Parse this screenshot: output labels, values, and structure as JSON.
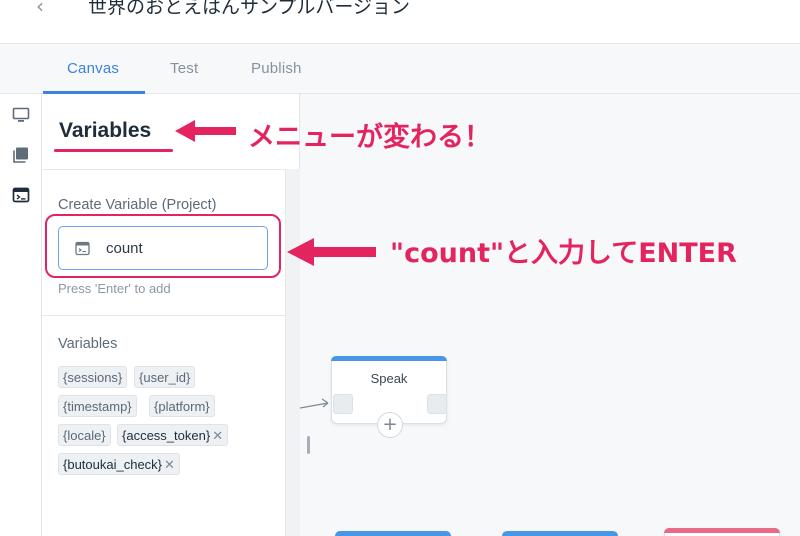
{
  "header": {
    "back_icon": "chevron-left-icon",
    "project_title": "世界のおとえはんサンプルバージョン"
  },
  "tabs": [
    {
      "label": "Canvas",
      "active": true
    },
    {
      "label": "Test",
      "active": false
    },
    {
      "label": "Publish",
      "active": false
    }
  ],
  "rail": {
    "icons": [
      "monitor-icon",
      "library-icon",
      "variables-icon"
    ]
  },
  "panel": {
    "title": "Variables",
    "create_label": "Create Variable (Project)",
    "input_value": "count",
    "input_icon": "variable-icon",
    "hint": "Press 'Enter' to add",
    "variables_label": "Variables",
    "variables": [
      {
        "name": "{sessions}",
        "removable": false
      },
      {
        "name": "{user_id}",
        "removable": false
      },
      {
        "name": "{timestamp}",
        "removable": false
      },
      {
        "name": "{platform}",
        "removable": false
      },
      {
        "name": "{locale}",
        "removable": false
      },
      {
        "name": "{access_token}",
        "removable": true
      },
      {
        "name": "{butoukai_check}",
        "removable": true
      }
    ],
    "remove_glyph": "✕"
  },
  "canvas": {
    "block_title": "Speak",
    "add_glyph": "+"
  },
  "annotations": {
    "menu_change": "メニューが変わる！",
    "enter_count": "\"count\"と入力してENTER"
  },
  "colors": {
    "accent": "#3d82e0",
    "annotation": "#e4245f",
    "block_speak": "#4796e7",
    "block_pink": "#e96a86"
  }
}
